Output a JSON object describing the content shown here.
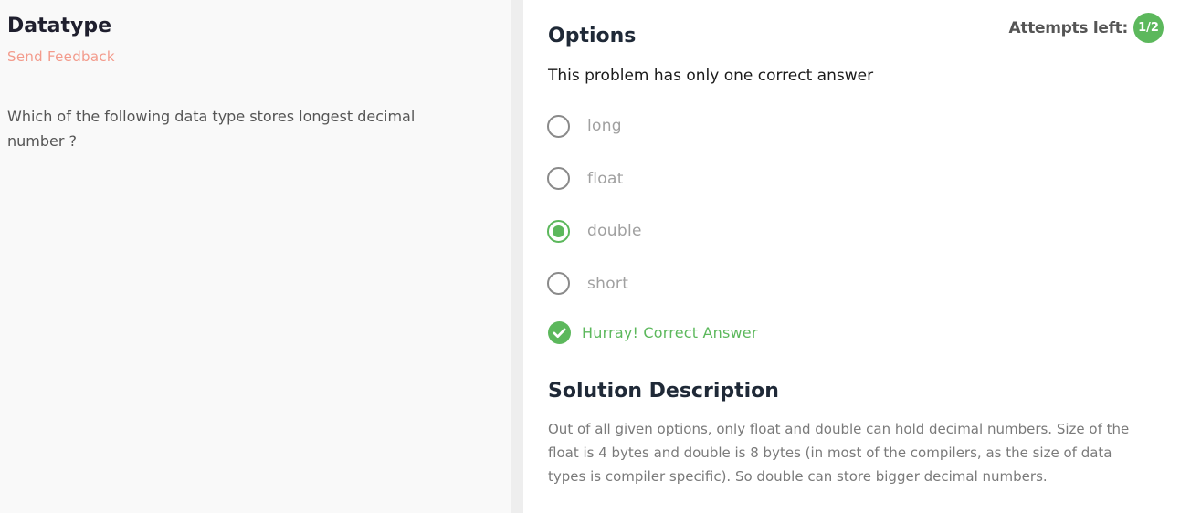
{
  "problem": {
    "title": "Datatype",
    "feedback_link": "Send Feedback",
    "question": "Which of the following data type stores longest decimal number ?"
  },
  "options_panel": {
    "heading": "Options",
    "attempts_label": "Attempts left:",
    "attempts_value": "1/2",
    "instructions": "This problem has only one correct answer",
    "options": [
      {
        "label": "long",
        "selected": false
      },
      {
        "label": "float",
        "selected": false
      },
      {
        "label": "double",
        "selected": true
      },
      {
        "label": "short",
        "selected": false
      }
    ],
    "result_message": "Hurray! Correct Answer"
  },
  "solution": {
    "heading": "Solution Description",
    "text": "Out of all given options, only float and double can hold decimal numbers. Size of the float is 4 bytes and double is 8 bytes (in most of the compilers, as the size of data types is compiler specific). So double can store bigger decimal numbers."
  },
  "colors": {
    "accent_green": "#5cb85c",
    "feedback_link": "#f39b8c",
    "left_panel_bg": "#f9f9f9"
  },
  "icons": {
    "result": "check-circle-icon"
  }
}
